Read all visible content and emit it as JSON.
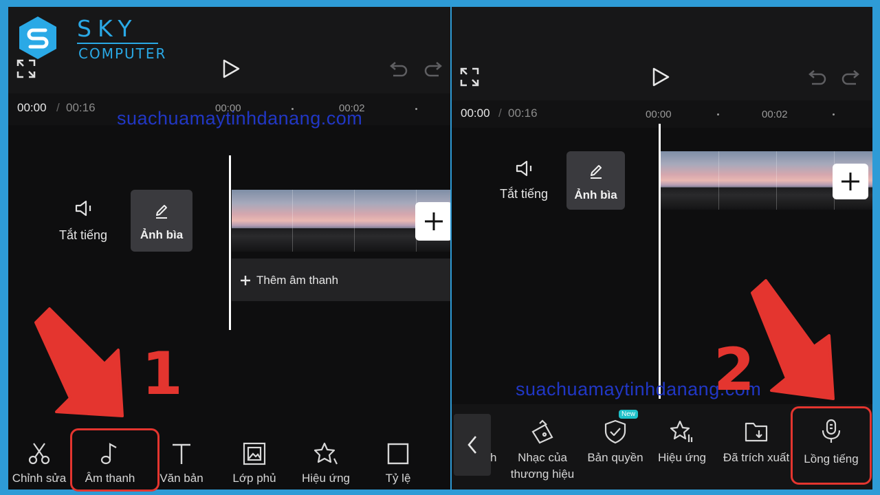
{
  "logo": {
    "brand": "SKY",
    "sub": "COMPUTER"
  },
  "watermark": "suachuamaytinhdanang.com",
  "colors": {
    "accent_red": "#e4352f",
    "frame_blue": "#2e9bd6",
    "new_badge": "#1fc1c9"
  },
  "left": {
    "time_current": "00:00",
    "time_sep": "/",
    "time_total": "00:16",
    "ruler": [
      "00:00",
      "00:02"
    ],
    "mute_label": "Tắt tiếng",
    "cover_label": "Ảnh bìa",
    "add_audio_label": "Thêm âm thanh",
    "tools": [
      {
        "label": "Chỉnh sửa",
        "icon": "scissors-icon"
      },
      {
        "label": "Âm thanh",
        "icon": "music-note-icon"
      },
      {
        "label": "Văn bản",
        "icon": "text-icon"
      },
      {
        "label": "Lớp phủ",
        "icon": "overlay-icon"
      },
      {
        "label": "Hiệu ứng",
        "icon": "effects-star-icon"
      },
      {
        "label": "Tỷ lệ",
        "icon": "ratio-square-icon"
      }
    ],
    "step_number": "1"
  },
  "right": {
    "time_current": "00:00",
    "time_sep": "/",
    "time_total": "00:16",
    "ruler": [
      "00:00",
      "00:02"
    ],
    "mute_label": "Tắt tiếng",
    "cover_label": "Ảnh bìa",
    "partial_label": "h",
    "new_badge": "New",
    "tools": [
      {
        "label_line1": "Nhạc của",
        "label_line2": "thương hiệu",
        "icon": "brand-music-icon"
      },
      {
        "label_line1": "Bản quyền",
        "icon": "copyright-shield-icon"
      },
      {
        "label_line1": "Hiệu ứng",
        "icon": "sound-effects-icon"
      },
      {
        "label_line1": "Đã trích xuất",
        "icon": "extracted-folder-icon"
      },
      {
        "label_line1": "Lồng tiếng",
        "icon": "microphone-icon"
      }
    ],
    "step_number": "2"
  }
}
